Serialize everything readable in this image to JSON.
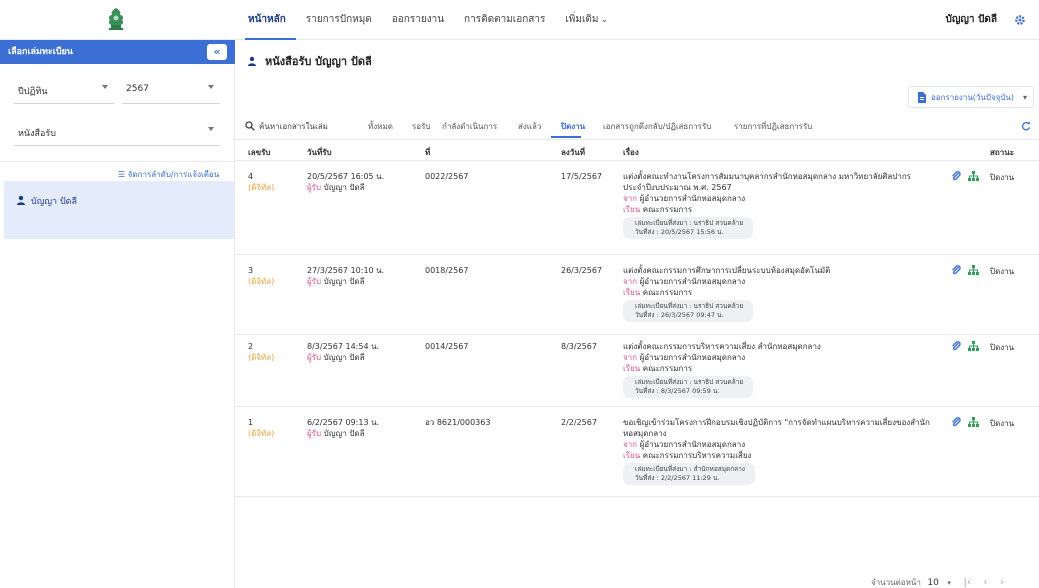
{
  "nav": {
    "items": [
      "หน้าหลัก",
      "รายการปักหมุด",
      "ออกรายงาน",
      "การติดตามเอกสาร",
      "เพิ่มเติม"
    ],
    "user": "บัญญา ปัดลี"
  },
  "sidebar": {
    "header": "เลือกเล่มทะเบียน",
    "collapse": "«",
    "year_type": "ปีปฏิทิน",
    "year": "2567",
    "book_type": "หนังสือรับ",
    "manage_link": "จัดการลำดับ/การแจ้งเตือน",
    "person": "บัญญา ปัดลี"
  },
  "main": {
    "title": "หนังสือรับ บัญญา ปัดลี",
    "export": "ออกรายงาน(วันปัจจุบัน)",
    "search": "ค้นหาเอกสารในเล่ม",
    "tabs": [
      "ทั้งหมด",
      "รอรับ",
      "กำลังดำเนินการ",
      "ส่งแล้ว",
      "ปิดงาน",
      "เอกสารถูกดึงกลับ/ปฏิเสธการรับ",
      "รายการที่ปฏิเสธการรับ"
    ],
    "columns": [
      "เลขรับ",
      "วันที่รับ",
      "ที่",
      "ลงวันที่",
      "เรื่อง",
      "สถานะ"
    ],
    "rows": [
      {
        "num": "4",
        "digital": "(ดิจิทัล)",
        "date": "20/5/2567 16:05 น.",
        "recv_label": "ผู้รับ",
        "recv": "บัญญา ปัดลี",
        "ref": "0022/2567",
        "doc_date": "17/5/2567",
        "subject": "แต่งตั้งคณะทำงานโครงการสัมมนาบุคลากรสำนักหอสมุดกลาง มหาวิทยาลัยศิลปากร ประจำปีงบประมาณ พ.ศ. 2567",
        "from_label": "จาก",
        "from": "ผู้อำนวยการสำนักหอสมุดกลาง",
        "to_label": "เรียน",
        "to": "คณะกรรมการ",
        "sender": "เล่มทะเบียนที่ส่งมา : นราธิป สวนคล้าย",
        "sent": "วันที่ส่ง : 20/5/2567 15:56 น.",
        "status": "ปิดงาน"
      },
      {
        "num": "3",
        "digital": "(ดิจิทัล)",
        "date": "27/3/2567 10:10 น.",
        "recv_label": "ผู้รับ",
        "recv": "บัญญา ปัดลี",
        "ref": "0018/2567",
        "doc_date": "26/3/2567",
        "subject": "แต่งตั้งคณะกรรมการศึกษาการเปลี่ยนระบบห้องสมุดอัตโนมัติ",
        "from_label": "จาก",
        "from": "ผู้อำนวยการสำนักหอสมุดกลาง",
        "to_label": "เรียน",
        "to": "คณะกรรมการ",
        "sender": "เล่มทะเบียนที่ส่งมา : นราธิป สวนคล้าย",
        "sent": "วันที่ส่ง : 26/3/2567 09:47 น.",
        "status": "ปิดงาน"
      },
      {
        "num": "2",
        "digital": "(ดิจิทัล)",
        "date": "8/3/2567 14:54 น.",
        "recv_label": "ผู้รับ",
        "recv": "บัญญา ปัดลี",
        "ref": "0014/2567",
        "doc_date": "8/3/2567",
        "subject": "แต่งตั้งคณะกรรมการบริหารความเสี่ยง สำนักหอสมุดกลาง",
        "from_label": "จาก",
        "from": "ผู้อำนวยการสำนักหอสมุดกลาง",
        "to_label": "เรียน",
        "to": "คณะกรรมการ",
        "sender": "เล่มทะเบียนที่ส่งมา : นราธิป สวนคล้าย",
        "sent": "วันที่ส่ง : 8/3/2567 09:59 น.",
        "status": "ปิดงาน"
      },
      {
        "num": "1",
        "digital": "(ดิจิทัล)",
        "date": "6/2/2567 09:13 น.",
        "recv_label": "ผู้รับ",
        "recv": "บัญญา ปัดลี",
        "ref": "อว 8621/000363",
        "doc_date": "2/2/2567",
        "subject": "ขอเชิญเข้าร่วมโครงการฝึกอบรมเชิงปฏิบัติการ \"การจัดทำแผนบริหารความเสี่ยงของสำนักหอสมุดกลาง",
        "from_label": "จาก",
        "from": "ผู้อำนวยการสำนักหอสมุดกลาง",
        "to_label": "เรียน",
        "to": "คณะกรรมการบริหารความเสี่ยง",
        "sender": "เล่มทะเบียนที่ส่งมา : สำนักหอสมุดกลาง",
        "sent": "วันที่ส่ง : 2/2/2567 11:29 น.",
        "status": "ปิดงาน"
      }
    ],
    "pager_label": "จำนวนต่อหน้า",
    "page_size": "10"
  },
  "colors": {
    "primary": "#3b6fd4",
    "accent_green": "#2e9e57",
    "digital": "#e8a33d",
    "pink": "#e0558a"
  }
}
